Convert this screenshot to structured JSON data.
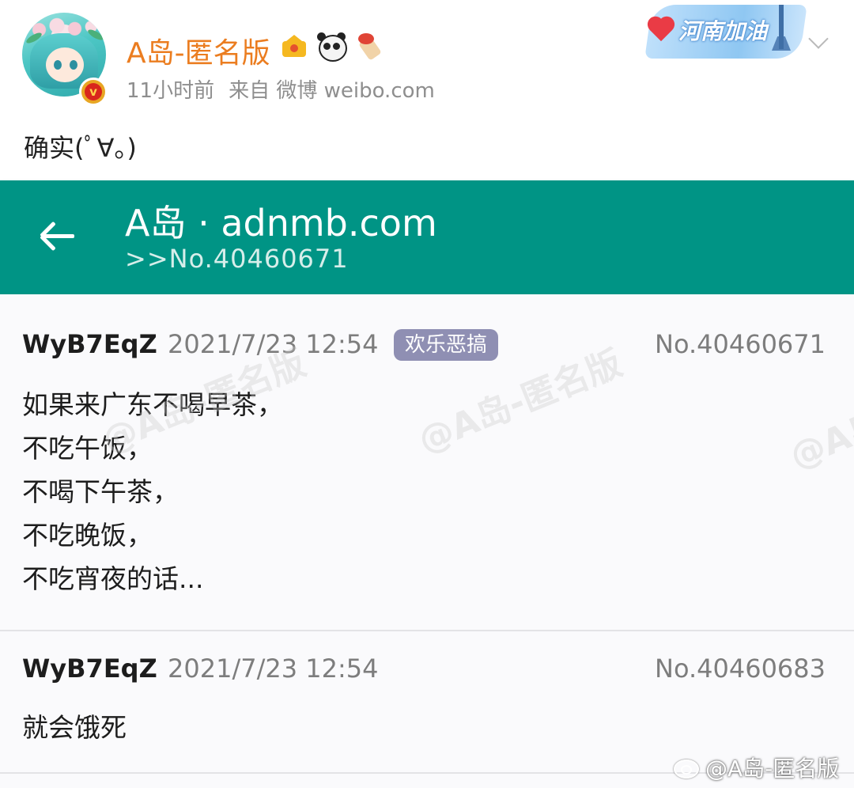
{
  "weibo": {
    "username": "A岛-匿名版",
    "time_ago": "11小时前",
    "source": "来自 微博 weibo.com",
    "post_text": "确实(ﾟ∀。)",
    "verified_mark": "v",
    "promo_banner": "河南加油",
    "watermark": "@A岛-匿名版",
    "badge_icons": [
      "crown-icon",
      "panda-icon",
      "firecracker-icon"
    ]
  },
  "app": {
    "title": "A岛 · adnmb.com",
    "subtitle": ">>No.40460671",
    "accent_color": "#009485"
  },
  "posts": [
    {
      "author": "WyB7EqZ",
      "time": "2021/7/23 12:54",
      "tag": "欢乐恶搞",
      "number": "No.40460671",
      "lines": [
        "如果来广东不喝早茶，",
        "不吃午饭，",
        "不喝下午茶，",
        "不吃晚饭，",
        "不吃宵夜的话..."
      ]
    },
    {
      "author": "WyB7EqZ",
      "time": "2021/7/23 12:54",
      "number": "No.40460683",
      "lines": [
        "就会饿死"
      ]
    }
  ]
}
